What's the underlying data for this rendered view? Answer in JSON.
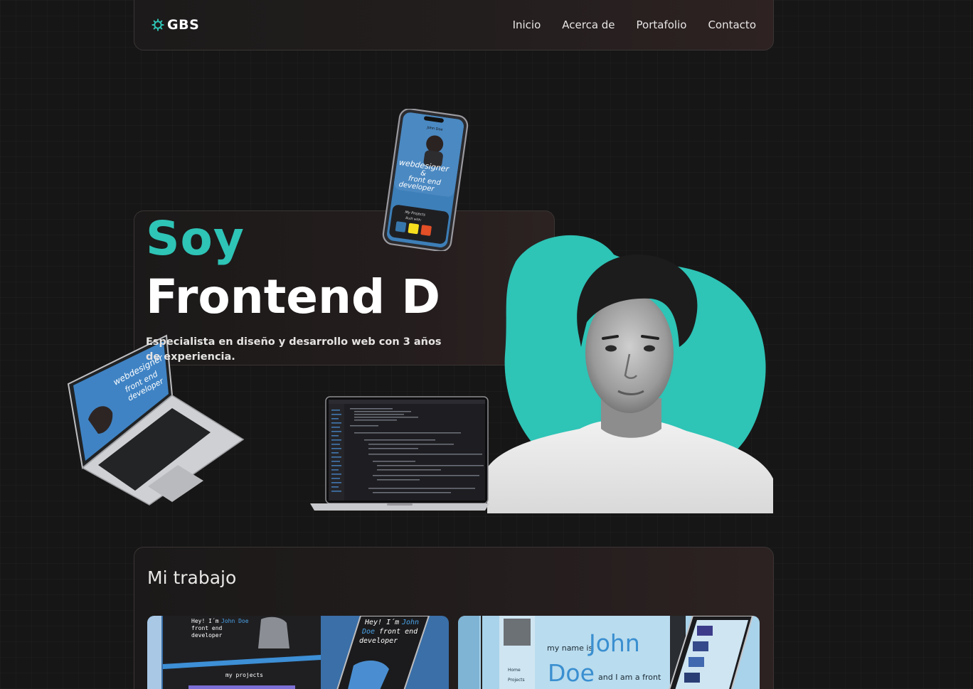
{
  "nav": {
    "brand": "GBS",
    "links": [
      "Inicio",
      "Acerca de",
      "Portafolio",
      "Contacto"
    ]
  },
  "hero": {
    "line1": "Soy",
    "line2": "Frontend D",
    "description": "Especialista en diseño y desarrollo web con 3 años de experiencia."
  },
  "phone_mockup": {
    "name": "John Doe",
    "headline_1": "webdesigner",
    "headline_2": "&",
    "headline_3": "front end",
    "headline_4": "developer",
    "projects": "My Projects",
    "built": "Built with:"
  },
  "laptop_mockup": {
    "headline_1": "webdesigner",
    "headline_2": "front end",
    "headline_3": "developer"
  },
  "work": {
    "title": "Mi trabajo",
    "thumb1": {
      "greeting_a": "Hey! I´m ",
      "greeting_name": "John Doe",
      "greeting_b": "front end",
      "greeting_c": "developer",
      "projects_label": "my projects",
      "side_a": "Hey! I´m ",
      "side_name": "John",
      "side_b": "Doe",
      "side_c": "front end",
      "side_d": "developer"
    },
    "thumb2": {
      "prefix": "my name is",
      "first": "John",
      "last": "Doe",
      "suffix": "and I am a front",
      "menu_1": "Home",
      "menu_2": "Projects"
    }
  },
  "colors": {
    "accent": "#2ec4b6",
    "background": "#171616",
    "card": "#221d1d"
  }
}
